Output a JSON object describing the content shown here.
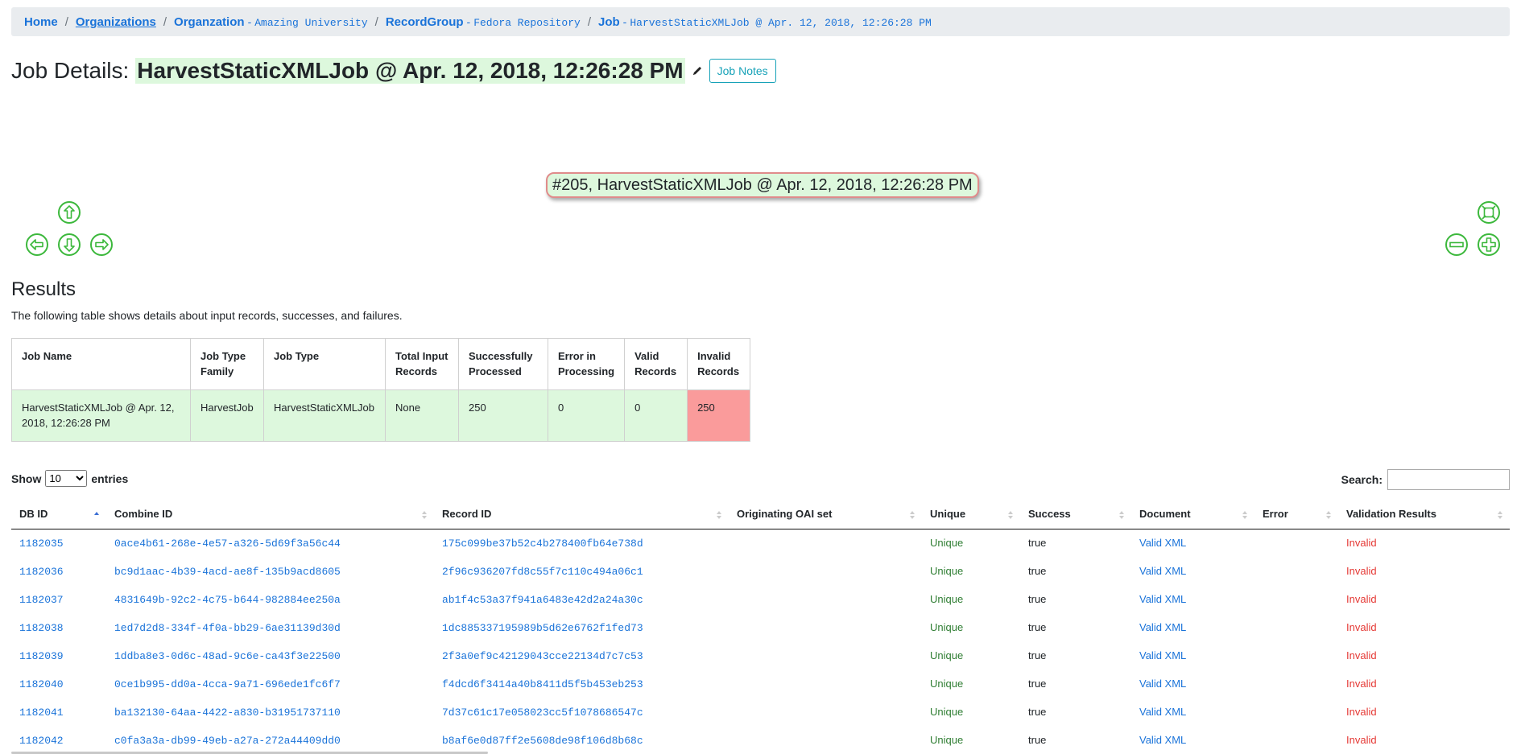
{
  "breadcrumb": {
    "home": "Home",
    "organizations": "Organizations",
    "organization_label": "Organzation",
    "organization_name": "Amazing University",
    "record_group_label": "RecordGroup",
    "record_group_name": "Fedora Repository",
    "job_label": "Job",
    "job_name": "HarvestStaticXMLJob @ Apr. 12, 2018, 12:26:28 PM",
    "separator": "/",
    "dash": "-"
  },
  "title": {
    "prefix": "Job Details:",
    "job_name": "HarvestStaticXMLJob @ Apr. 12, 2018, 12:26:28 PM",
    "notes_button": "Job Notes"
  },
  "graph": {
    "node_label": "#205, HarvestStaticXMLJob @ Apr. 12, 2018, 12:26:28 PM"
  },
  "results": {
    "heading": "Results",
    "description": "The following table shows details about input records, successes, and failures.",
    "columns": [
      "Job Name",
      "Job Type Family",
      "Job Type",
      "Total Input Records",
      "Successfully Processed",
      "Error in Processing",
      "Valid Records",
      "Invalid Records"
    ],
    "row": [
      "HarvestStaticXMLJob @ Apr. 12, 2018, 12:26:28 PM",
      "HarvestJob",
      "HarvestStaticXMLJob",
      "None",
      "250",
      "0",
      "0",
      "250"
    ]
  },
  "datatable": {
    "show_label": "Show",
    "page_size": "10",
    "entries_label": "entries",
    "search_label": "Search:",
    "search_value": "",
    "columns": [
      "DB ID",
      "Combine ID",
      "Record ID",
      "Originating OAI set",
      "Unique",
      "Success",
      "Document",
      "Error",
      "Validation Results"
    ],
    "rows": [
      {
        "db_id": "1182035",
        "combine_id": "0ace4b61-268e-4e57-a326-5d69f3a56c44",
        "record_id": "175c099be37b52c4b278400fb64e738d",
        "oai_set": "",
        "unique": "Unique",
        "success": "true",
        "document": "Valid XML",
        "error": "",
        "validation": "Invalid"
      },
      {
        "db_id": "1182036",
        "combine_id": "bc9d1aac-4b39-4acd-ae8f-135b9acd8605",
        "record_id": "2f96c936207fd8c55f7c110c494a06c1",
        "oai_set": "",
        "unique": "Unique",
        "success": "true",
        "document": "Valid XML",
        "error": "",
        "validation": "Invalid"
      },
      {
        "db_id": "1182037",
        "combine_id": "4831649b-92c2-4c75-b644-982884ee250a",
        "record_id": "ab1f4c53a37f941a6483e42d2a24a30c",
        "oai_set": "",
        "unique": "Unique",
        "success": "true",
        "document": "Valid XML",
        "error": "",
        "validation": "Invalid"
      },
      {
        "db_id": "1182038",
        "combine_id": "1ed7d2d8-334f-4f0a-bb29-6ae31139d30d",
        "record_id": "1dc885337195989b5d62e6762f1fed73",
        "oai_set": "",
        "unique": "Unique",
        "success": "true",
        "document": "Valid XML",
        "error": "",
        "validation": "Invalid"
      },
      {
        "db_id": "1182039",
        "combine_id": "1ddba8e3-0d6c-48ad-9c6e-ca43f3e22500",
        "record_id": "2f3a0ef9c42129043cce22134d7c7c53",
        "oai_set": "",
        "unique": "Unique",
        "success": "true",
        "document": "Valid XML",
        "error": "",
        "validation": "Invalid"
      },
      {
        "db_id": "1182040",
        "combine_id": "0ce1b995-dd0a-4cca-9a71-696ede1fc6f7",
        "record_id": "f4dcd6f3414a40b8411d5f5b453eb253",
        "oai_set": "",
        "unique": "Unique",
        "success": "true",
        "document": "Valid XML",
        "error": "",
        "validation": "Invalid"
      },
      {
        "db_id": "1182041",
        "combine_id": "ba132130-64aa-4422-a830-b31951737110",
        "record_id": "7d37c61c17e058023cc5f1078686547c",
        "oai_set": "",
        "unique": "Unique",
        "success": "true",
        "document": "Valid XML",
        "error": "",
        "validation": "Invalid"
      },
      {
        "db_id": "1182042",
        "combine_id": "c0fa3a3a-db99-49eb-a27a-272a44409dd0",
        "record_id": "b8af6e0d87ff2e5608de98f106d8b68c",
        "oai_set": "",
        "unique": "Unique",
        "success": "true",
        "document": "Valid XML",
        "error": "",
        "validation": "Invalid"
      }
    ]
  },
  "icons": {
    "pan_up": "arrow-up-circle-icon",
    "pan_left": "arrow-left-circle-icon",
    "pan_down": "arrow-down-circle-icon",
    "pan_right": "arrow-right-circle-icon",
    "fit": "zoom-extends-icon",
    "zoom_out": "zoom-out-icon",
    "zoom_in": "zoom-in-icon",
    "edit": "pencil-icon"
  },
  "colors": {
    "link": "#1a73d9",
    "success_cell": "#ddf8dd",
    "invalid_cell": "#fa9b9b",
    "nav_icon": "#3cb83c",
    "unique_text": "#2e7d32",
    "invalid_text": "#e53935"
  }
}
